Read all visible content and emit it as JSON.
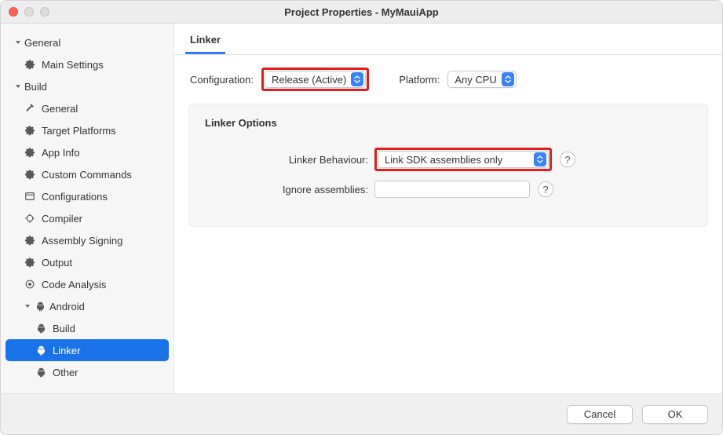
{
  "title": "Project Properties - MyMauiApp",
  "sidebar": {
    "general": {
      "label": "General",
      "main_settings": "Main Settings"
    },
    "build": {
      "label": "Build",
      "general": "General",
      "target_platforms": "Target Platforms",
      "app_info": "App Info",
      "custom_commands": "Custom Commands",
      "configurations": "Configurations",
      "compiler": "Compiler",
      "assembly_signing": "Assembly Signing",
      "output": "Output",
      "code_analysis": "Code Analysis"
    },
    "android": {
      "label": "Android",
      "build": "Build",
      "linker": "Linker",
      "other": "Other"
    }
  },
  "tab": {
    "linker": "Linker"
  },
  "config": {
    "configuration_label": "Configuration:",
    "configuration_value": "Release (Active)",
    "platform_label": "Platform:",
    "platform_value": "Any CPU"
  },
  "panel": {
    "title": "Linker Options",
    "linker_behaviour_label": "Linker Behaviour:",
    "linker_behaviour_value": "Link SDK assemblies only",
    "ignore_assemblies_label": "Ignore assemblies:",
    "ignore_assemblies_value": ""
  },
  "footer": {
    "cancel": "Cancel",
    "ok": "OK"
  },
  "help_glyph": "?"
}
